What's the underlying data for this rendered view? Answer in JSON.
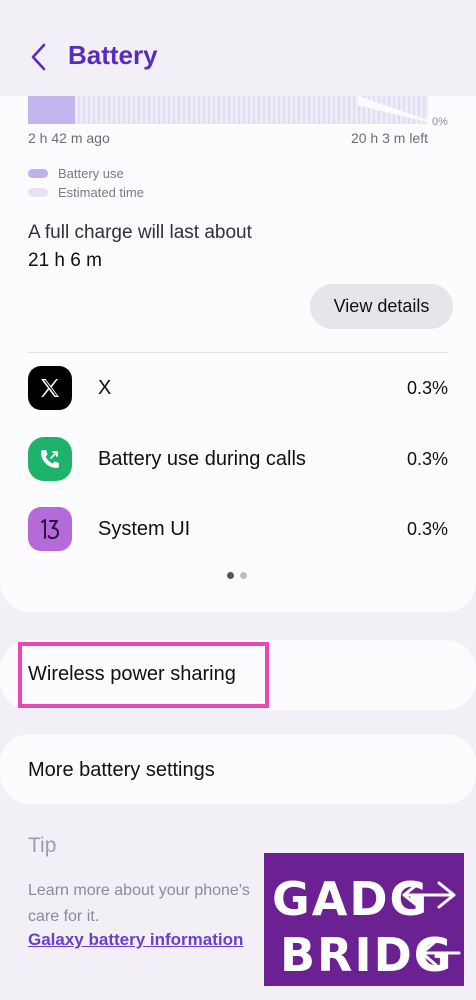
{
  "header": {
    "title": "Battery"
  },
  "usage_chart": {
    "zero_label": "0%",
    "time_ago": "2 h 42 m ago",
    "time_left": "20 h 3 m left",
    "legend_use": "Battery use",
    "legend_estimated": "Estimated time"
  },
  "charge": {
    "label": "A full charge will last about",
    "value": "21 h 6 m"
  },
  "view_details_label": "View details",
  "apps": [
    {
      "name": "X",
      "percent": "0.3%"
    },
    {
      "name": "Battery use during calls",
      "percent": "0.3%"
    },
    {
      "name": "System UI",
      "percent": "0.3%"
    }
  ],
  "wireless_power_sharing": "Wireless power sharing",
  "more_battery_settings": "More battery settings",
  "tip": {
    "title": "Tip",
    "line1": "Learn more about your phone's",
    "line2": "care for it.",
    "link": "Galaxy battery information"
  },
  "watermark": {
    "line1": "GADG",
    "line2": "BRIDG"
  },
  "colors": {
    "accent": "#5b2bbd",
    "highlight": "#ea46b5",
    "calls_icon": "#1db36b",
    "system_ui_icon": "#b46ad8",
    "watermark_bg": "#6b2192"
  }
}
